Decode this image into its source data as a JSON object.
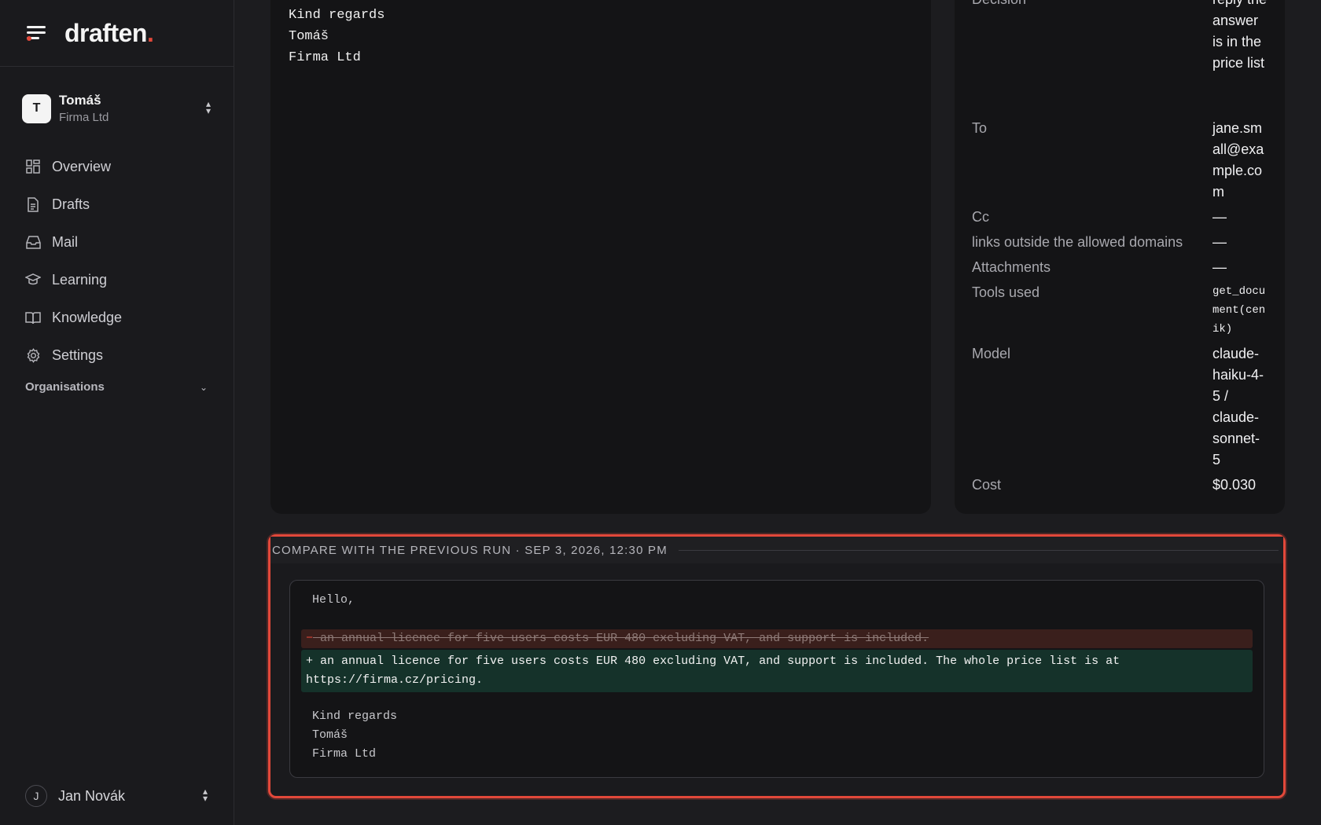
{
  "brand": {
    "name": "draften",
    "dot": "."
  },
  "org": {
    "avatar": "T",
    "name": "Tomáš",
    "company": "Firma Ltd"
  },
  "nav": [
    {
      "label": "Overview",
      "icon": "grid-icon"
    },
    {
      "label": "Drafts",
      "icon": "document-icon"
    },
    {
      "label": "Mail",
      "icon": "inbox-icon"
    },
    {
      "label": "Learning",
      "icon": "graduation-cap-icon"
    },
    {
      "label": "Knowledge",
      "icon": "book-icon"
    },
    {
      "label": "Settings",
      "icon": "gear-icon"
    }
  ],
  "organisations_label": "Organisations",
  "user": {
    "avatar": "J",
    "name": "Jan Novák"
  },
  "draft_body": {
    "lines": [
      "Kind regards",
      "Tomáš",
      "Firma Ltd"
    ]
  },
  "meta": {
    "decision_key": "Decision",
    "decision_val": "reply the answer is in the price list",
    "to_key": "To",
    "to_val": "jane.small@example.com",
    "cc_key": "Cc",
    "cc_val": "—",
    "links_key": "links outside the allowed domains",
    "links_val": "—",
    "attachments_key": "Attachments",
    "attachments_val": "—",
    "tools_key": "Tools used",
    "tools_val": "get_document(cenik)",
    "model_key": "Model",
    "model_val": "claude-haiku-4-5 / claude-sonnet-5",
    "cost_key": "Cost",
    "cost_val": "$0.030"
  },
  "compare": {
    "title": "COMPARE WITH THE PREVIOUS RUN · SEP 3, 2026, 12:30 PM",
    "ctx_top": "Hello,",
    "del_sign": "−",
    "del_text": " an annual licence for five users costs EUR 480 excluding VAT, and support is included.",
    "add_text": "+ an annual licence for five users costs EUR 480 excluding VAT, and support is included. The whole price list is at https://firma.cz/pricing.",
    "ctx_bottom": [
      "Kind regards",
      "Tomáš",
      "Firma Ltd"
    ]
  },
  "colors": {
    "accent": "#e2483a",
    "added_bg": "#15322a",
    "removed_bg": "#3a1f1c"
  }
}
